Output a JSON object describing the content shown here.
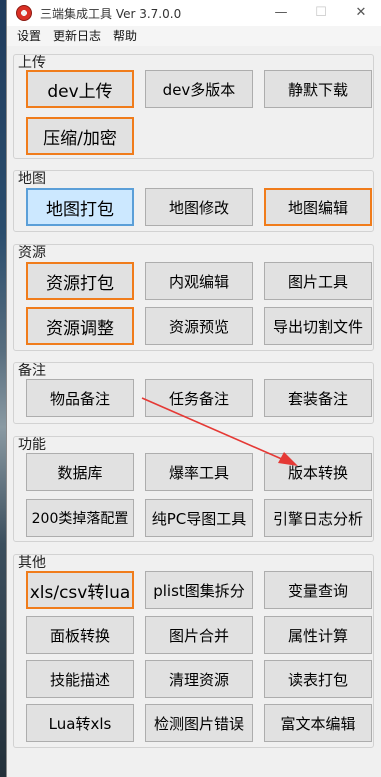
{
  "window": {
    "title": "三端集成工具 Ver 3.7.0.0",
    "minimize": "—",
    "maximize": "☐",
    "close": "✕"
  },
  "menu": [
    "设置",
    "更新日志",
    "帮助"
  ],
  "groups": {
    "upload": {
      "title": "上传",
      "buttons": [
        "dev上传",
        "dev多版本",
        "静默下载",
        "压缩/加密"
      ]
    },
    "map": {
      "title": "地图",
      "buttons": [
        "地图打包",
        "地图修改",
        "地图编辑"
      ]
    },
    "resource": {
      "title": "资源",
      "buttons": [
        "资源打包",
        "内观编辑",
        "图片工具",
        "资源调整",
        "资源预览",
        "导出切割文件"
      ]
    },
    "note": {
      "title": "备注",
      "buttons": [
        "物品备注",
        "任务备注",
        "套装备注"
      ]
    },
    "function": {
      "title": "功能",
      "buttons": [
        "数据库",
        "爆率工具",
        "版本转换",
        "200类掉落配置",
        "纯PC导图工具",
        "引擎日志分析"
      ]
    },
    "other": {
      "title": "其他",
      "buttons": [
        "xls/csv转lua",
        "plist图集拆分",
        "变量查询",
        "面板转换",
        "图片合并",
        "属性计算",
        "技能描述",
        "清理资源",
        "读表打包",
        "Lua转xls",
        "检测图片错误",
        "富文本编辑"
      ]
    }
  },
  "colors": {
    "highlight_border": "#f07c1b",
    "selected_fill": "#cce8ff",
    "annotation_arrow": "#e53935"
  }
}
